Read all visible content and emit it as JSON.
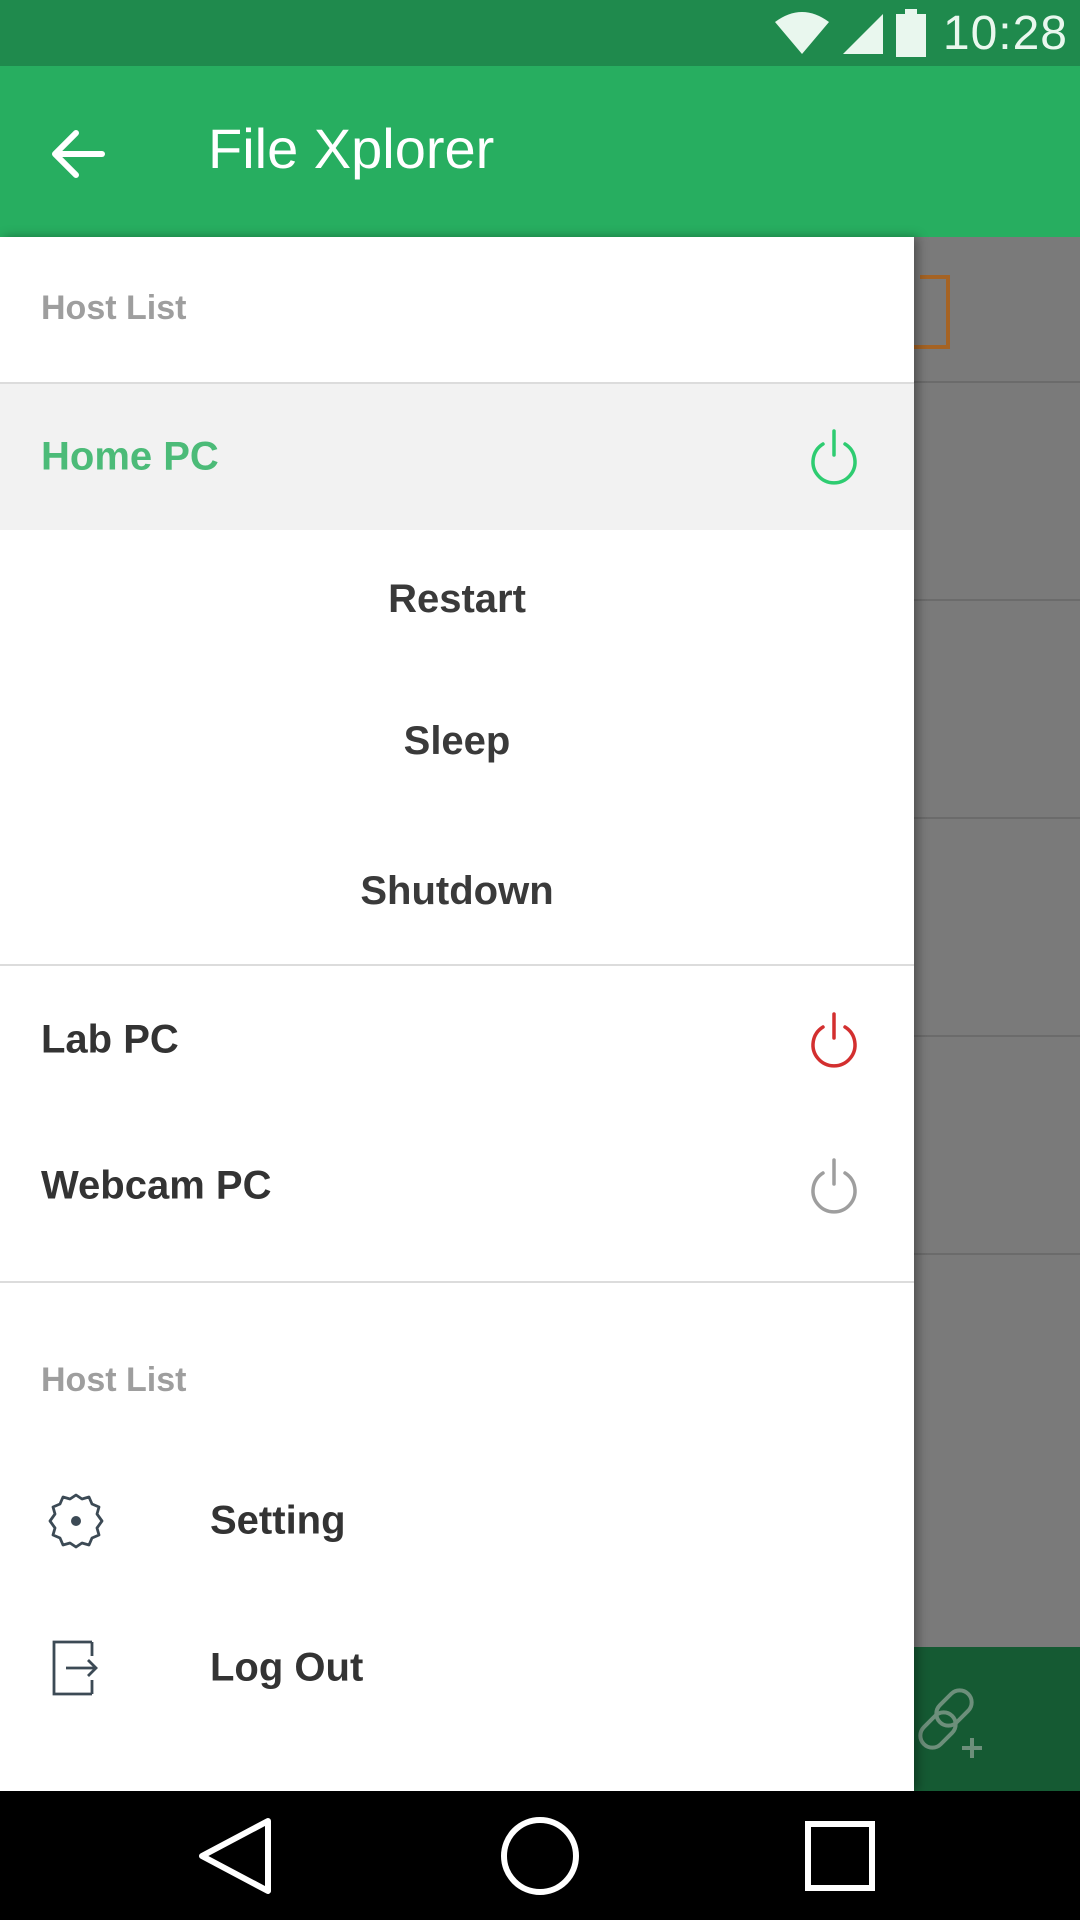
{
  "status_bar": {
    "time": "10:28",
    "icons": [
      "wifi-icon",
      "signal-icon",
      "battery-icon"
    ]
  },
  "toolbar": {
    "title": "File Xplorer",
    "back_icon": "arrow-left-icon"
  },
  "drawer": {
    "hosts_header": "Host List",
    "hosts": [
      {
        "name": "Home PC",
        "status_color": "#2ecc71",
        "selected": true
      },
      {
        "name": "Lab PC",
        "status_color": "#d32f2f",
        "selected": false
      },
      {
        "name": "Webcam PC",
        "status_color": "#9e9e9e",
        "selected": false
      }
    ],
    "actions": [
      "Restart",
      "Sleep",
      "Shutdown"
    ],
    "menu_header": "Host List",
    "menu": [
      {
        "label": "Setting",
        "icon": "gear-icon"
      },
      {
        "label": "Log Out",
        "icon": "logout-icon"
      }
    ]
  },
  "colors": {
    "status_bar": "#1f8a4d",
    "toolbar": "#27ae60",
    "accent": "#4cbb78"
  },
  "nav_bar": {
    "buttons": [
      "back-triangle-icon",
      "home-circle-icon",
      "recents-square-icon"
    ]
  }
}
